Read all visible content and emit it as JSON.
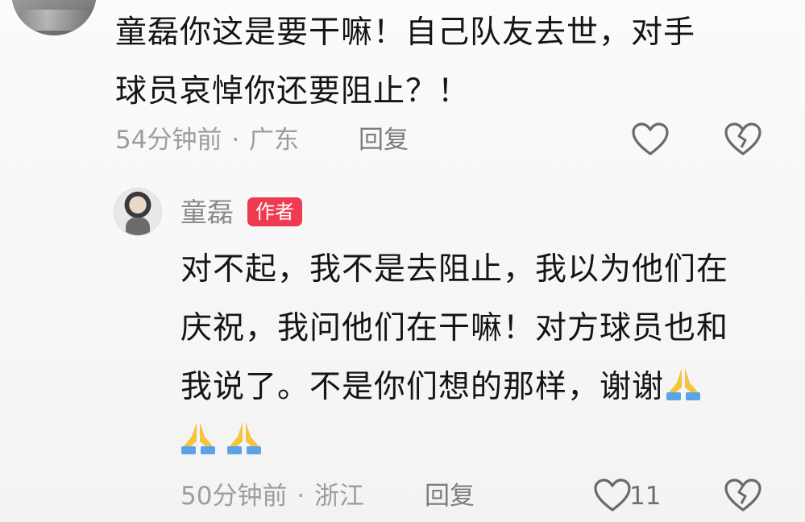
{
  "comment_top": {
    "lines": [
      "童磊你这是要干嘛！自己队友去世，对手",
      "球员哀悼你还要阻止？！"
    ],
    "time": "54分钟前",
    "separator": "·",
    "location": "广东",
    "reply_label": "回复",
    "like_icon": "heart-outline-icon",
    "dislike_icon": "broken-heart-icon"
  },
  "comment_reply": {
    "author": "童磊",
    "badge": "作者",
    "lines": [
      "对不起，我不是去阻止，我以为他们在",
      "庆祝，我问他们在干嘛！对方球员也和",
      "我说了。不是你们想的那样，谢谢"
    ],
    "emoji": "folded-hands-emoji",
    "time": "50分钟前",
    "separator": "·",
    "location": "浙江",
    "reply_label": "回复",
    "like_count": "11",
    "like_icon": "heart-outline-icon",
    "dislike_icon": "broken-heart-icon"
  },
  "colors": {
    "badge_bg": "#ef3b52",
    "text_primary": "#151515",
    "text_meta": "#9d9d9d",
    "emoji_yellow": "#f6c33c",
    "emoji_blue": "#5aa3e6"
  }
}
